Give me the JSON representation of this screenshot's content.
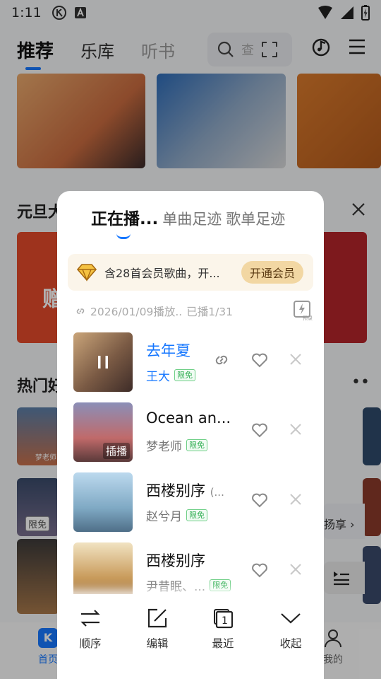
{
  "status_bar": {
    "time": "1:11"
  },
  "background": {
    "tabs": [
      "推荐",
      "乐库",
      "听书"
    ],
    "search_placeholder": "查",
    "section_1": "元旦大",
    "section_2": "热门好",
    "card_text_1": "赠",
    "free_tag": "限免",
    "share_text": "扬享 ›",
    "bottom_nav": {
      "home": "首页",
      "mine": "我的"
    },
    "card_label": "梦老师"
  },
  "sheet": {
    "tabs": [
      "正在播...",
      "单曲足迹",
      "歌单足迹"
    ],
    "vip": {
      "text": "含28首会员歌曲，开...",
      "button": "开通会员"
    },
    "history": {
      "date": "2026/01/09播放..",
      "played": "已播1/31"
    },
    "songs": [
      {
        "title": "去年夏",
        "extra": "",
        "artist": "王大",
        "badge": "限免",
        "cover_tag": "",
        "playing": true
      },
      {
        "title": "Ocean an...",
        "extra": "",
        "artist": "梦老师",
        "badge": "限免",
        "cover_tag": "插播",
        "playing": false
      },
      {
        "title": "西楼别序",
        "extra": "(...",
        "artist": "赵兮月",
        "badge": "限免",
        "cover_tag": "",
        "playing": false
      },
      {
        "title": "西楼别序",
        "extra": "",
        "artist": "尹昔眠、...",
        "badge": "限免",
        "cover_tag": "",
        "playing": false
      }
    ],
    "actions": {
      "order": "顺序",
      "edit": "编辑",
      "recent": "最近",
      "collapse": "收起"
    }
  },
  "colors": {
    "accent": "#1677ff",
    "free_badge": "#2fae52",
    "vip_button": "#f2d7a3"
  }
}
